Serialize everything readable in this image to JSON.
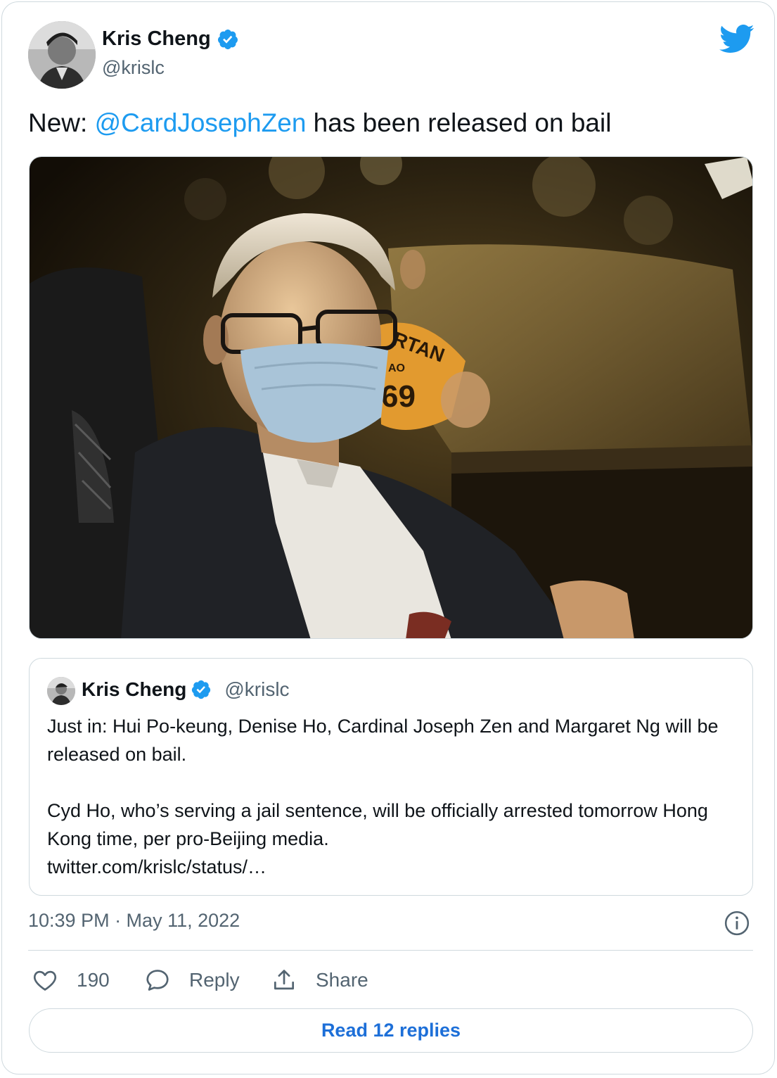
{
  "tweet": {
    "author_name": "Kris Cheng",
    "author_handle": "@krislc",
    "text_prefix": "New: ",
    "mention": "@CardJosephZen",
    "text_suffix": " has been released on bail",
    "timestamp": "10:39 PM · May 11, 2022"
  },
  "quoted": {
    "author_name": "Kris Cheng",
    "author_handle": "@krislc",
    "paragraph_1": "Just in: Hui Po-keung, Denise Ho, Cardinal Joseph Zen and Margaret Ng will be released on bail.",
    "paragraph_2": "Cyd Ho, who’s serving a jail sentence, will be officially arrested tomorrow Hong Kong time, per pro-Beijing media.",
    "link": "twitter.com/krislc/status/…"
  },
  "actions": {
    "like_count": "190",
    "reply_label": "Reply",
    "share_label": "Share",
    "read_replies_label": "Read 12 replies"
  },
  "photo": {
    "sign_text_1": "RTAN",
    "sign_text_2": "AO",
    "sign_text_3": "69"
  },
  "icons": {
    "verified": "verified-badge-icon",
    "logo": "twitter-bird-icon",
    "info": "info-icon",
    "like": "heart-icon",
    "reply": "speech-bubble-icon",
    "share": "share-upload-icon"
  },
  "colors": {
    "accent": "#1d9bf0",
    "link_button": "#1d6fd8",
    "secondary_text": "#536471",
    "border": "#cfd9de"
  }
}
